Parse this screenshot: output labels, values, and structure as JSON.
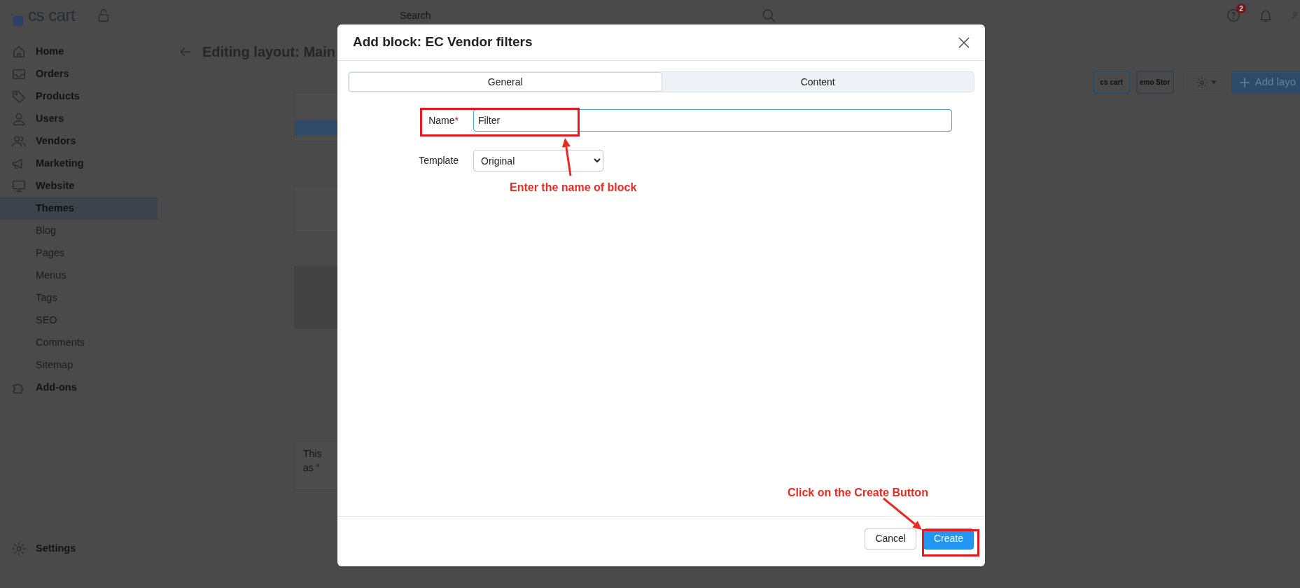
{
  "topbar": {
    "logo": "cs cart",
    "search": {
      "placeholder": "Search"
    },
    "help_badge": "2"
  },
  "sidebar": {
    "items": [
      {
        "label": "Home",
        "selected": false
      },
      {
        "label": "Orders",
        "selected": false
      },
      {
        "label": "Products",
        "selected": false
      },
      {
        "label": "Users",
        "selected": false
      },
      {
        "label": "Vendors",
        "selected": false
      },
      {
        "label": "Marketing",
        "selected": false
      },
      {
        "label": "Website",
        "selected": false,
        "children": [
          {
            "label": "Themes",
            "selected": true
          },
          {
            "label": "Blog",
            "selected": false
          },
          {
            "label": "Pages",
            "selected": false
          },
          {
            "label": "Menus",
            "selected": false
          },
          {
            "label": "Tags",
            "selected": false
          },
          {
            "label": "SEO",
            "selected": false
          },
          {
            "label": "Comments",
            "selected": false
          },
          {
            "label": "Sitemap",
            "selected": false
          }
        ]
      },
      {
        "label": "Add-ons",
        "selected": false
      }
    ],
    "footer_item": {
      "label": "Settings",
      "selected": false
    }
  },
  "page": {
    "title": "Editing layout: Main",
    "store_logos": [
      {
        "text": "cs cart",
        "selected": true
      },
      {
        "text": "emo Stor",
        "selected": false
      }
    ],
    "add_button": "Add layo",
    "note_lines": [
      "This",
      "as “"
    ]
  },
  "modal": {
    "title": "Add block: EC Vendor filters",
    "tabs": [
      {
        "label": "General",
        "selected": true
      },
      {
        "label": "Content",
        "selected": false
      }
    ],
    "fields": [
      {
        "kind": "input",
        "label": "Name",
        "required_mark": "*",
        "value": "Filter",
        "focused": true
      },
      {
        "kind": "select",
        "label": "Template",
        "value": "Original",
        "focused": false
      }
    ],
    "buttons": [
      {
        "label": "Cancel",
        "kind": "secondary"
      },
      {
        "label": "Create",
        "kind": "primary"
      }
    ]
  },
  "annotations": [
    {
      "text": "Enter the name of block"
    },
    {
      "text": "Click on the Create Button"
    }
  ]
}
